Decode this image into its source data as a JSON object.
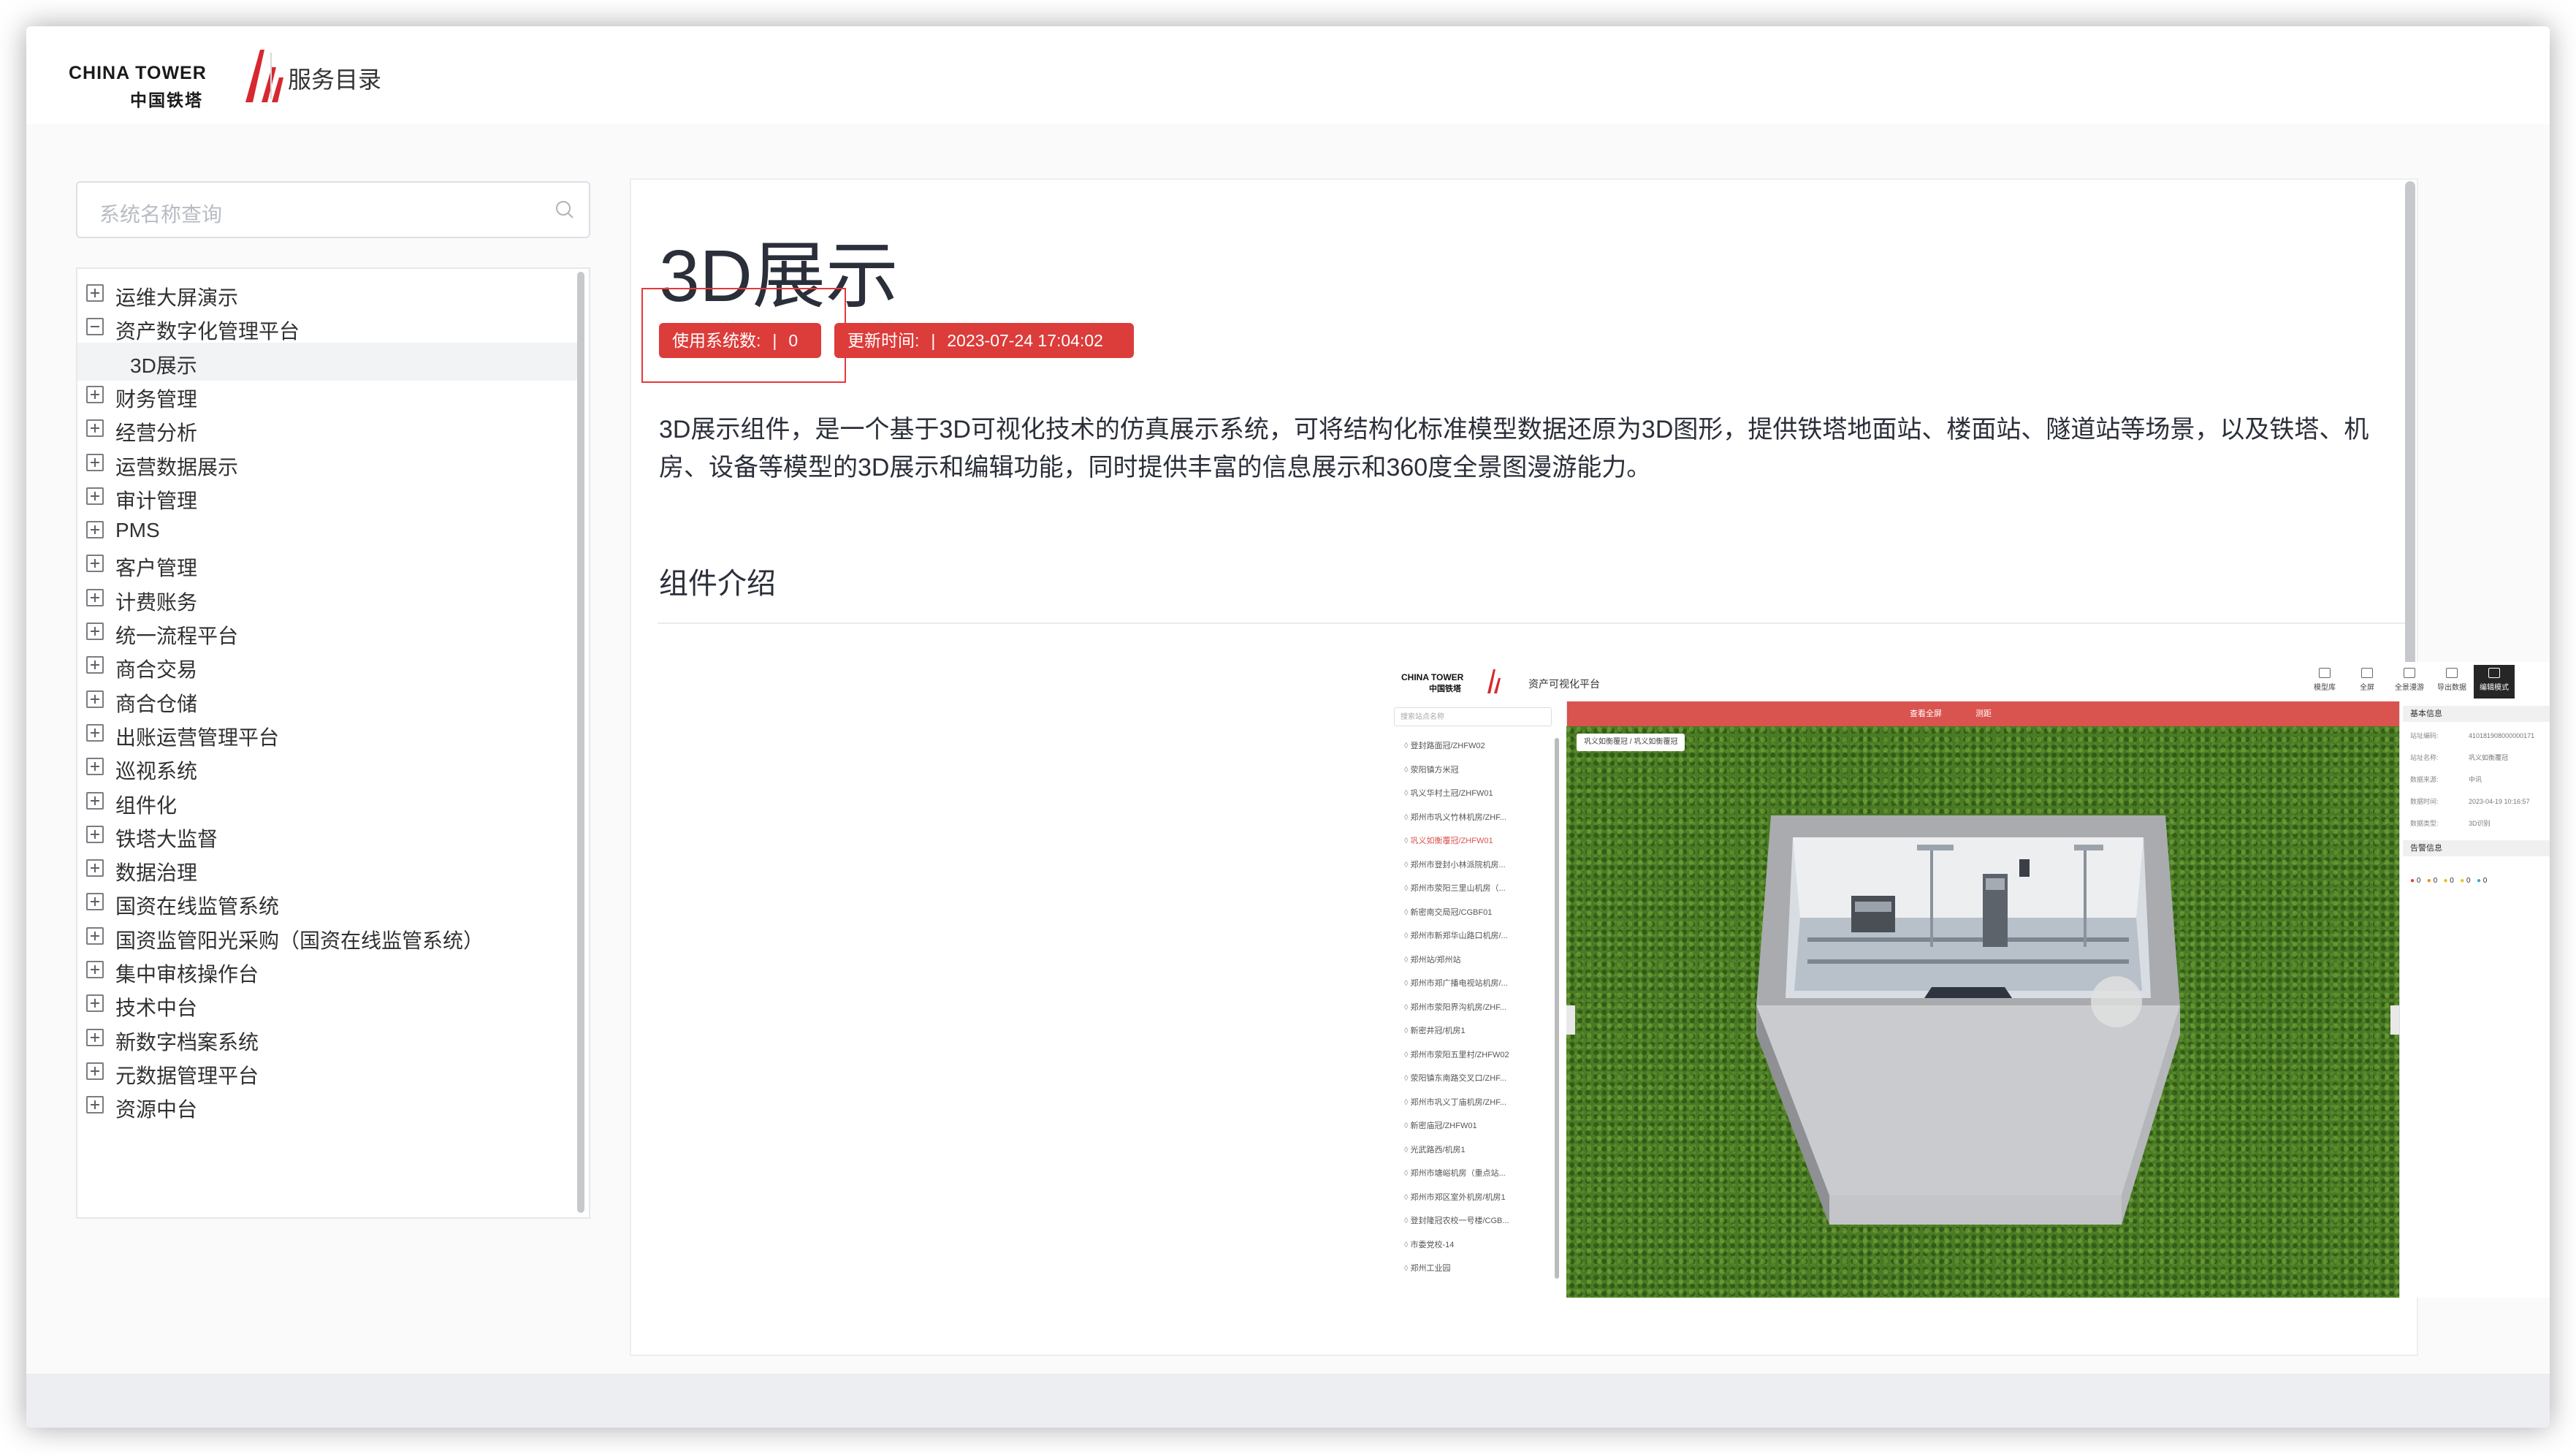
{
  "header": {
    "logo_en": "CHINA TOWER",
    "logo_cn": "中国铁塔",
    "title": "服务目录"
  },
  "sidebar": {
    "search_placeholder": "系统名称查询",
    "items": [
      {
        "label": "运维大屏演示",
        "expanded": false
      },
      {
        "label": "资产数字化管理平台",
        "expanded": true
      },
      {
        "label": "3D展示",
        "child": true,
        "active": true
      },
      {
        "label": "财务管理",
        "expanded": false
      },
      {
        "label": "经营分析",
        "expanded": false
      },
      {
        "label": "运营数据展示",
        "expanded": false
      },
      {
        "label": "审计管理",
        "expanded": false
      },
      {
        "label": "PMS",
        "expanded": false
      },
      {
        "label": "客户管理",
        "expanded": false
      },
      {
        "label": "计费账务",
        "expanded": false
      },
      {
        "label": "统一流程平台",
        "expanded": false
      },
      {
        "label": "商合交易",
        "expanded": false
      },
      {
        "label": "商合仓储",
        "expanded": false
      },
      {
        "label": "出账运营管理平台",
        "expanded": false
      },
      {
        "label": "巡视系统",
        "expanded": false
      },
      {
        "label": "组件化",
        "expanded": false
      },
      {
        "label": "铁塔大监督",
        "expanded": false
      },
      {
        "label": "数据治理",
        "expanded": false
      },
      {
        "label": "国资在线监管系统",
        "expanded": false
      },
      {
        "label": "国资监管阳光采购（国资在线监管系统）",
        "expanded": false
      },
      {
        "label": "集中审核操作台",
        "expanded": false
      },
      {
        "label": "技术中台",
        "expanded": false
      },
      {
        "label": "新数字档案系统",
        "expanded": false
      },
      {
        "label": "元数据管理平台",
        "expanded": false
      },
      {
        "label": "资源中台",
        "expanded": false
      }
    ]
  },
  "content": {
    "title": "3D展示",
    "tag_usage_label": "使用系统数:",
    "tag_usage_sep": "|",
    "tag_usage_value": "0",
    "tag_update_label": "更新时间:",
    "tag_update_sep": "|",
    "tag_update_value": "2023-07-24 17:04:02",
    "description": "3D展示组件，是一个基于3D可视化技术的仿真展示系统，可将结构化标准模型数据还原为3D图形，提供铁塔地面站、楼面站、隧道站等场景，以及铁塔、机房、设备等模型的3D展示和编辑功能，同时提供丰富的信息展示和360度全景图漫游能力。",
    "section_title": "组件介绍"
  },
  "screenshot": {
    "logo_en": "CHINA TOWER",
    "logo_cn": "中国铁塔",
    "title": "资产可视化平台",
    "tools": [
      "模型库",
      "全屏",
      "全景漫游",
      "导出数据",
      "编辑模式"
    ],
    "red_bar": [
      "查看全屏",
      "测距"
    ],
    "search_placeholder": "搜索站点名称",
    "breadcrumb": "巩义如衡覆冠 / 巩义如衡覆冠",
    "list_items": [
      "登封路面冠/ZHFW02",
      "荥阳镇方米冠",
      "巩义华村土冠/ZHFW01",
      "郑州市巩义竹林机房/ZHF...",
      "巩义如衡覆冠/ZHFW01",
      "郑州市登封小林派院机房...",
      "郑州市荥阳三里山机房（...",
      "新密南交局冠/CGBF01",
      "郑州市新郑华山路口机房/...",
      "郑州站/郑州站",
      "郑州市郑广播电视站机房/...",
      "郑州市荥阳界沟机房/ZHF...",
      "新密井冠/机房1",
      "郑州市荥阳五里村/ZHFW02",
      "荥阳镇东南路交叉口/ZHF...",
      "郑州市巩义丁庙机房/ZHF...",
      "新密庙冠/ZHFW01",
      "光武路西/机房1",
      "郑州市塘峪机房（重点站...",
      "郑州市郑区室外机房/机房1",
      "登封隆冠农校一号楼/CGB...",
      "市委党校-14",
      "郑州工业园"
    ],
    "right_panel": {
      "basic_header": "基本信息",
      "rows": [
        {
          "k": "站址编码:",
          "v": "410181908000000171"
        },
        {
          "k": "站址名称:",
          "v": "巩义如衡覆冠"
        },
        {
          "k": "数据来源:",
          "v": "中讯"
        },
        {
          "k": "数据时间:",
          "v": "2023-04-19 10:16:57"
        },
        {
          "k": "数据类型:",
          "v": "3D识别"
        }
      ],
      "alarm_header": "告警信息",
      "alarm_counts": [
        "0",
        "0",
        "0",
        "0",
        "0"
      ]
    }
  },
  "colors": {
    "tag_red": "#dc3c3a",
    "highlight_border": "#e5393b",
    "logo_red": "#d7282f"
  }
}
